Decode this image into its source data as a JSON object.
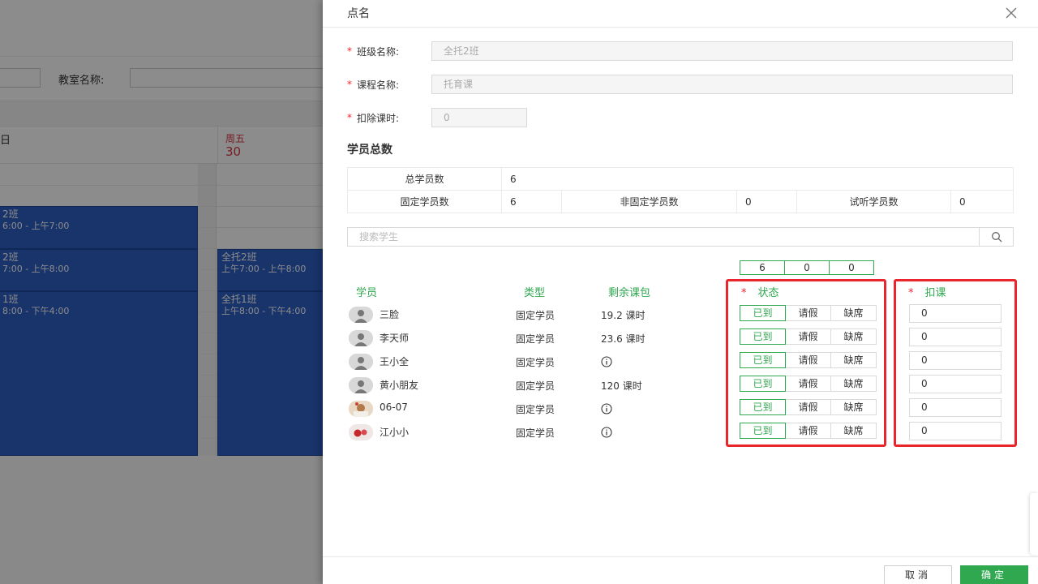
{
  "background": {
    "room_label": "教室名称:",
    "day_prev": "日",
    "day_name": "周五",
    "day_number": "30",
    "events": [
      {
        "name": "2班",
        "time": "6:00 - 上午7:00"
      },
      {
        "name": "2班",
        "time": "7:00 - 上午8:00"
      },
      {
        "name": "1班",
        "time": "8:00 - 下午4:00"
      },
      {
        "name": "全托2班",
        "time": "上午7:00 - 上午8:00"
      },
      {
        "name": "全托1班",
        "time": "上午8:00 - 下午4:00"
      }
    ]
  },
  "drawer": {
    "title": "点名",
    "fields": {
      "class_label": "班级名称:",
      "class_value": "全托2班",
      "course_label": "课程名称:",
      "course_value": "托育课",
      "deduct_label": "扣除课时:",
      "deduct_value": "0"
    },
    "section_title": "学员总数",
    "stats": {
      "total_label": "总学员数",
      "total_value": "6",
      "fixed_label": "固定学员数",
      "fixed_value": "6",
      "nonfixed_label": "非固定学员数",
      "nonfixed_value": "0",
      "trial_label": "试听学员数",
      "trial_value": "0"
    },
    "search_placeholder": "搜索学生",
    "counts": [
      "6",
      "0",
      "0"
    ],
    "columns": {
      "student": "学员",
      "type": "类型",
      "remaining": "剩余课包",
      "status_req": "*",
      "status": "状态",
      "deduct_req": "*",
      "deduct": "扣课"
    },
    "status_options": [
      "已到",
      "请假",
      "缺席"
    ],
    "students": [
      {
        "name": "三脸",
        "type": "固定学员",
        "remaining": "19.2 课时",
        "deduct": "0",
        "avatar": "default"
      },
      {
        "name": "李天师",
        "type": "固定学员",
        "remaining": "23.6 课时",
        "deduct": "0",
        "avatar": "default"
      },
      {
        "name": "王小全",
        "type": "固定学员",
        "remaining": "",
        "deduct": "0",
        "avatar": "default"
      },
      {
        "name": "黄小朋友",
        "type": "固定学员",
        "remaining": "120 课时",
        "deduct": "0",
        "avatar": "default"
      },
      {
        "name": "06-07",
        "type": "固定学员",
        "remaining": "",
        "deduct": "0",
        "avatar": "photo"
      },
      {
        "name": "江小小",
        "type": "固定学员",
        "remaining": "",
        "deduct": "0",
        "avatar": "photo-red"
      }
    ],
    "footer": {
      "cancel": "取消",
      "confirm": "确定"
    }
  },
  "colors": {
    "accent_green": "#2fa84f",
    "required_red": "#f5222d",
    "highlight_red": "#e8262b",
    "event_blue": "#2d5fc4"
  }
}
